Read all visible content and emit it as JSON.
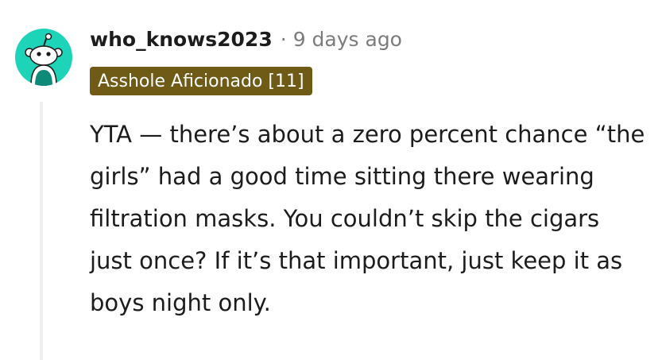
{
  "comment": {
    "avatar_icon": "snoo-avatar-icon",
    "avatar_color": "#1dd3b8",
    "username": "who_knows2023",
    "separator": "·",
    "timestamp": "9 days ago",
    "flair": "Asshole Aficionado [11]",
    "flair_color": "#6f5a16",
    "body": "YTA — there’s about a zero percent chance “the girls” had a good time sitting there wearing filtration masks. You couldn’t skip the cigars just once? If it’s that important, just keep it as boys night only."
  }
}
